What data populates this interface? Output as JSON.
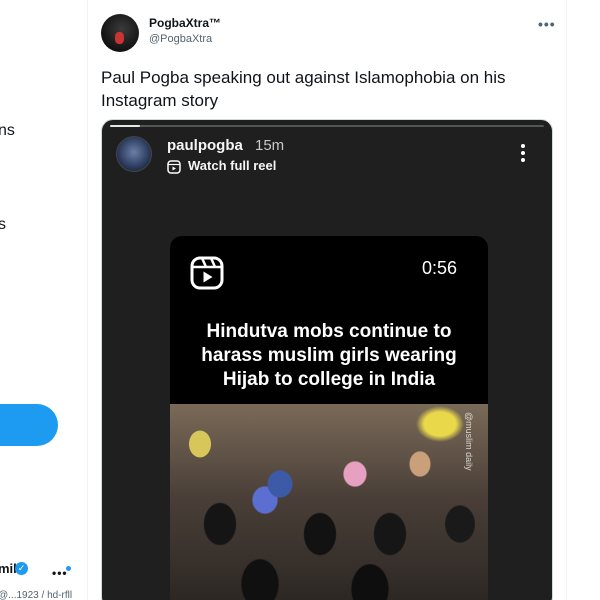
{
  "sidebar": {
    "nav_fragment_1": "ns",
    "nav_fragment_2": "s",
    "account_name": "mil",
    "account_more": "•••",
    "account_handle": "@...1923 / hd-rfll"
  },
  "tweet": {
    "display_name": "PogbaXtra™",
    "handle": "@PogbaXtra",
    "more": "•••",
    "text": "Paul Pogba speaking out against Islamophobia on his Instagram story"
  },
  "story": {
    "username": "paulpogba",
    "time": "15m",
    "watch_label": "Watch full reel",
    "progress": 0.07,
    "reel": {
      "duration": "0:56",
      "caption": "Hindutva mobs continue to harass muslim girls wearing Hijab to college in India",
      "watermark": "@muslim daily"
    }
  },
  "colors": {
    "accent": "#1d9bf0",
    "story_bg": "#1f1f1f",
    "reel_bg": "#000000"
  },
  "icons": {
    "more": "more-icon",
    "reel": "reel-icon",
    "verified": "verified-badge-icon"
  }
}
